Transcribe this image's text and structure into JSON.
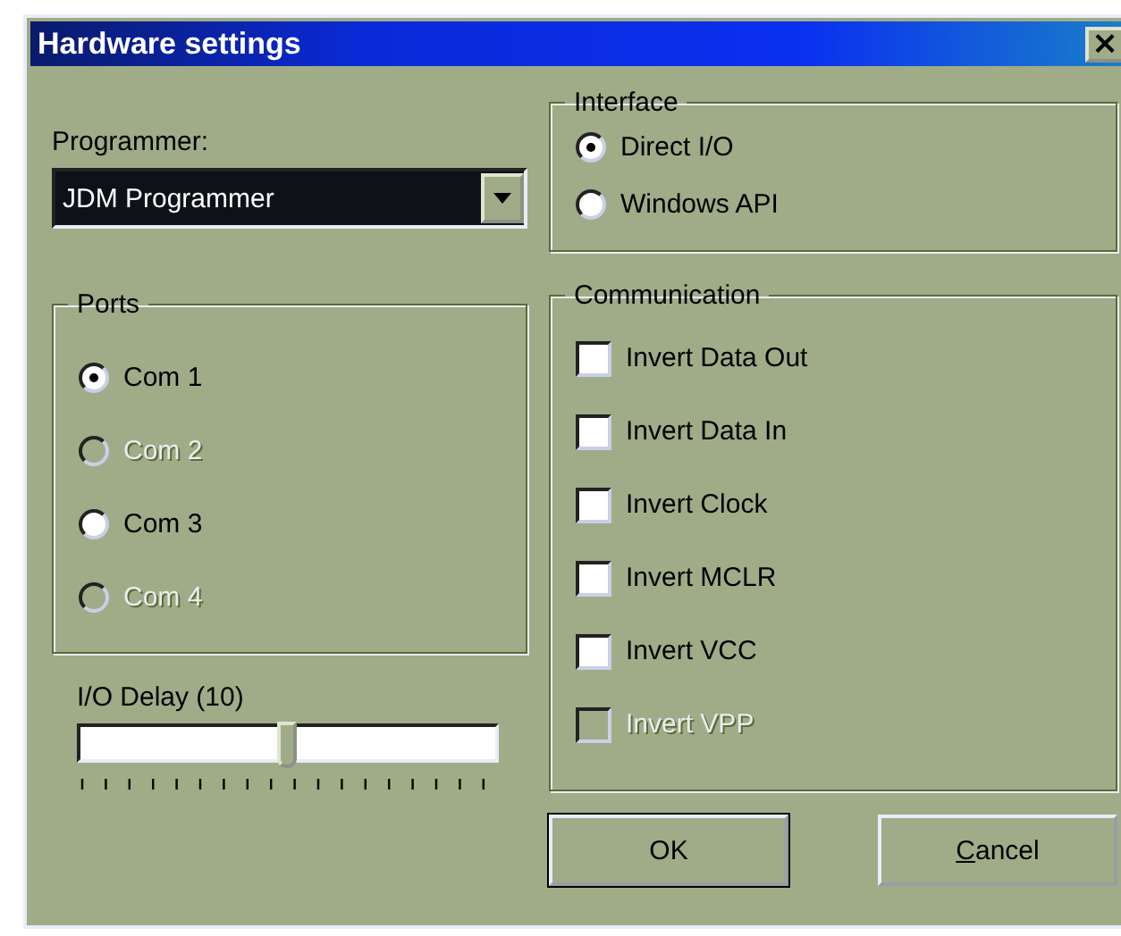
{
  "window": {
    "title": "Hardware settings",
    "close": "×"
  },
  "programmer": {
    "label": "Programmer:",
    "value": "JDM Programmer"
  },
  "ports": {
    "title": "Ports",
    "options": [
      {
        "label": "Com 1",
        "selected": true,
        "disabled": false
      },
      {
        "label": "Com 2",
        "selected": false,
        "disabled": true
      },
      {
        "label": "Com 3",
        "selected": false,
        "disabled": false
      },
      {
        "label": "Com 4",
        "selected": false,
        "disabled": true
      }
    ]
  },
  "io_delay": {
    "label": "I/O Delay (10)",
    "level": 0.5
  },
  "interface": {
    "title": "Interface",
    "options": [
      {
        "label": "Direct I/O",
        "selected": true,
        "disabled": false
      },
      {
        "label": "Windows API",
        "selected": false,
        "disabled": false
      }
    ]
  },
  "communication": {
    "title": "Communication",
    "options": [
      {
        "label": "Invert Data Out",
        "checked": false,
        "disabled": false
      },
      {
        "label": "Invert Data In",
        "checked": false,
        "disabled": false
      },
      {
        "label": "Invert Clock",
        "checked": false,
        "disabled": false
      },
      {
        "label": "Invert MCLR",
        "checked": false,
        "disabled": false
      },
      {
        "label": "Invert VCC",
        "checked": false,
        "disabled": false
      },
      {
        "label": "Invert VPP",
        "checked": false,
        "disabled": true
      }
    ]
  },
  "buttons": [
    {
      "label": "OK",
      "default": true
    },
    {
      "label": "Cancel",
      "default": false
    }
  ]
}
